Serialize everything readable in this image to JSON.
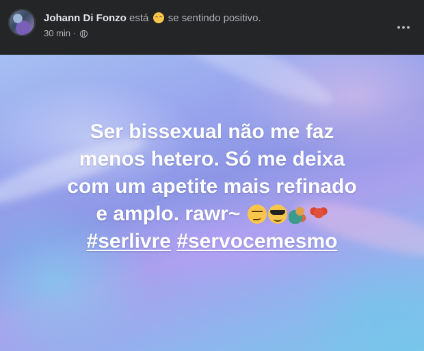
{
  "post": {
    "author": "Johann Di Fonzo",
    "feeling_verb": "está",
    "feeling_text": "se sentindo positivo.",
    "time": "30 min",
    "separator": "·"
  },
  "message": {
    "lines": [
      "Ser bissexual não me faz",
      "menos hetero. Só me deixa",
      "com um apetite mais refinado",
      "e amplo. rawr~"
    ],
    "emojis": [
      "smirking-face",
      "smiling-face-with-sunglasses",
      "dragon-face",
      "maple-leaf"
    ],
    "hashtags": [
      "#serlivre",
      "#servocemesmo"
    ]
  },
  "icons": {
    "privacy": "globe-icon",
    "menu": "more-options-icon",
    "feeling": "relieved-face-icon"
  }
}
